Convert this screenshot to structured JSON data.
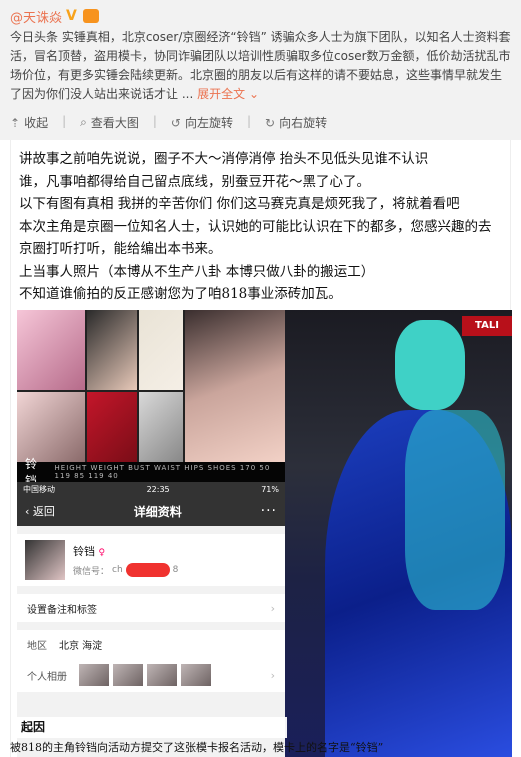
{
  "post": {
    "author": "@天诛焱",
    "verified_mark": "V",
    "text": "今日头条 实锤真相，北京coser/京圈经济“铃铛” 诱骗众多人士为旗下团队，以知名人士资料套活，冒名顶替，盗用模卡，协同诈骗团队以培训性质骗取多位coser数万金额，低价劫活扰乱市场价位，有更多实锤会陆续更新。北京圈的朋友以后有这样的请不要姑息，这些事情早就发生了因为你们没人站出来说话才让 ...",
    "expand": "展开全文",
    "expand_icon": "chevron-down-icon"
  },
  "actions": {
    "collapse": "收起",
    "view_large": "查看大图",
    "rotate_left": "向左旋转",
    "rotate_right": "向右旋转"
  },
  "image": {
    "intro_lines": [
      "讲故事之前咱先说说，圈子不大～消停消停 抬头不见低头见谁不认识",
      "谁，凡事咱都得给自己留点底线，别蚕豆开花～黑了心了。",
      "以下有图有真相 我拼的辛苦你们 你们这马赛克真是烦死我了，将就着看吧",
      "本次主角是京圈一位知名人士，认识她的可能比认识在下的都多，您感兴趣的去",
      "京圈打听打听，能给编出本书来。",
      "上当事人照片（本博从不生产八卦 本博只做八卦的搬运工）",
      "不知道谁偷拍的反正感谢您为了咱818事业添砖加瓦。"
    ],
    "comp_card": {
      "name": "铃铛",
      "stats": "HEIGHT WEIGHT BUST WAIST HIPS SHOES 170 50 119 85 119 40"
    },
    "phone": {
      "carrier": "中国移动",
      "time": "22:35",
      "battery": "71%",
      "back": "返回",
      "title": "详细资料",
      "more": "···",
      "profile_name": "铃铛",
      "wechat_label": "微信号：",
      "wechat_id_start": "ch",
      "wechat_id_end": "8",
      "row_remark": "设置备注和标签",
      "region_label": "地区",
      "region_value": "北京 海淀",
      "album_label": "个人相册"
    },
    "cosplay_sign": "TALI",
    "caption_head": "起因",
    "caption_text": "被818的主角铃铛向活动方提交了这张模卡报名活动，模卡上的名字是“铃铛”"
  },
  "colors": {
    "accent": "#eb7350",
    "header_bg": "#f2f2f2",
    "redact": "#f0322f"
  }
}
